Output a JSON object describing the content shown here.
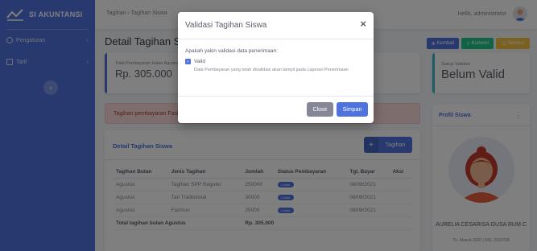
{
  "sidebar": {
    "brand": "SI AKUNTANSI",
    "items": [
      {
        "label": "Pengaturan",
        "icon": "gear-icon"
      },
      {
        "label": "Tarif",
        "icon": "tag-icon"
      }
    ],
    "toggle_icon": "chevron-left-icon"
  },
  "topbar": {
    "breadcrumb": "Tagihan  ›  Tagihan Siswa",
    "greeting": "Hello, administrator"
  },
  "page": {
    "title": "Detail Tagihan Siswa",
    "buttons": {
      "back": "Kembali",
      "receipt": "Kuitansi",
      "validate": "Validasi"
    }
  },
  "total_card": {
    "label": "Total Pembayaran bulan Agustus",
    "value": "Rp. 305.000"
  },
  "status_card": {
    "label": "Status Validasi",
    "value": "Belum Valid"
  },
  "alert": {
    "text": "Tagihan pembayaran Fashion"
  },
  "detail": {
    "title": "Detail Tagihan Siswa",
    "add_button": "Tagihan",
    "headers": [
      "Tagihan Bulan",
      "Jenis Tagihan",
      "Jumlah",
      "Status Pembayaran",
      "Tgl. Bayar",
      "Aksi"
    ],
    "rows": [
      {
        "bulan": "Agustus",
        "jenis": "Tagihan SPP Reguler",
        "jumlah": "250000",
        "status": "Lunas",
        "tgl": "08/08/2021"
      },
      {
        "bulan": "Agustus",
        "jenis": "Tari Tradisional",
        "jumlah": "30000",
        "status": "Lunas",
        "tgl": "08/08/2021"
      },
      {
        "bulan": "Agustus",
        "jenis": "Fashion",
        "jumlah": "25000",
        "status": "Lunas",
        "tgl": "08/08/2021"
      }
    ],
    "total_label": "Total tagihan bulan Agustus",
    "total_value": "Rp. 305.000"
  },
  "profile": {
    "title": "Profil Siswa",
    "name": "AURELIA CESARISA GUSA RUM C",
    "meta": "Th. Masuk 2020 | NIS: 2020708"
  },
  "modal": {
    "title": "Validasi Tagihan Siswa",
    "question": "Apakah yakin validasi data penerimaan:",
    "checkbox_label": "Valid",
    "help_text": "Data Pembayaran yang telah divalidasi akan tampil pada Laporan Penerimaan",
    "close": "Close",
    "save": "Simpan"
  }
}
